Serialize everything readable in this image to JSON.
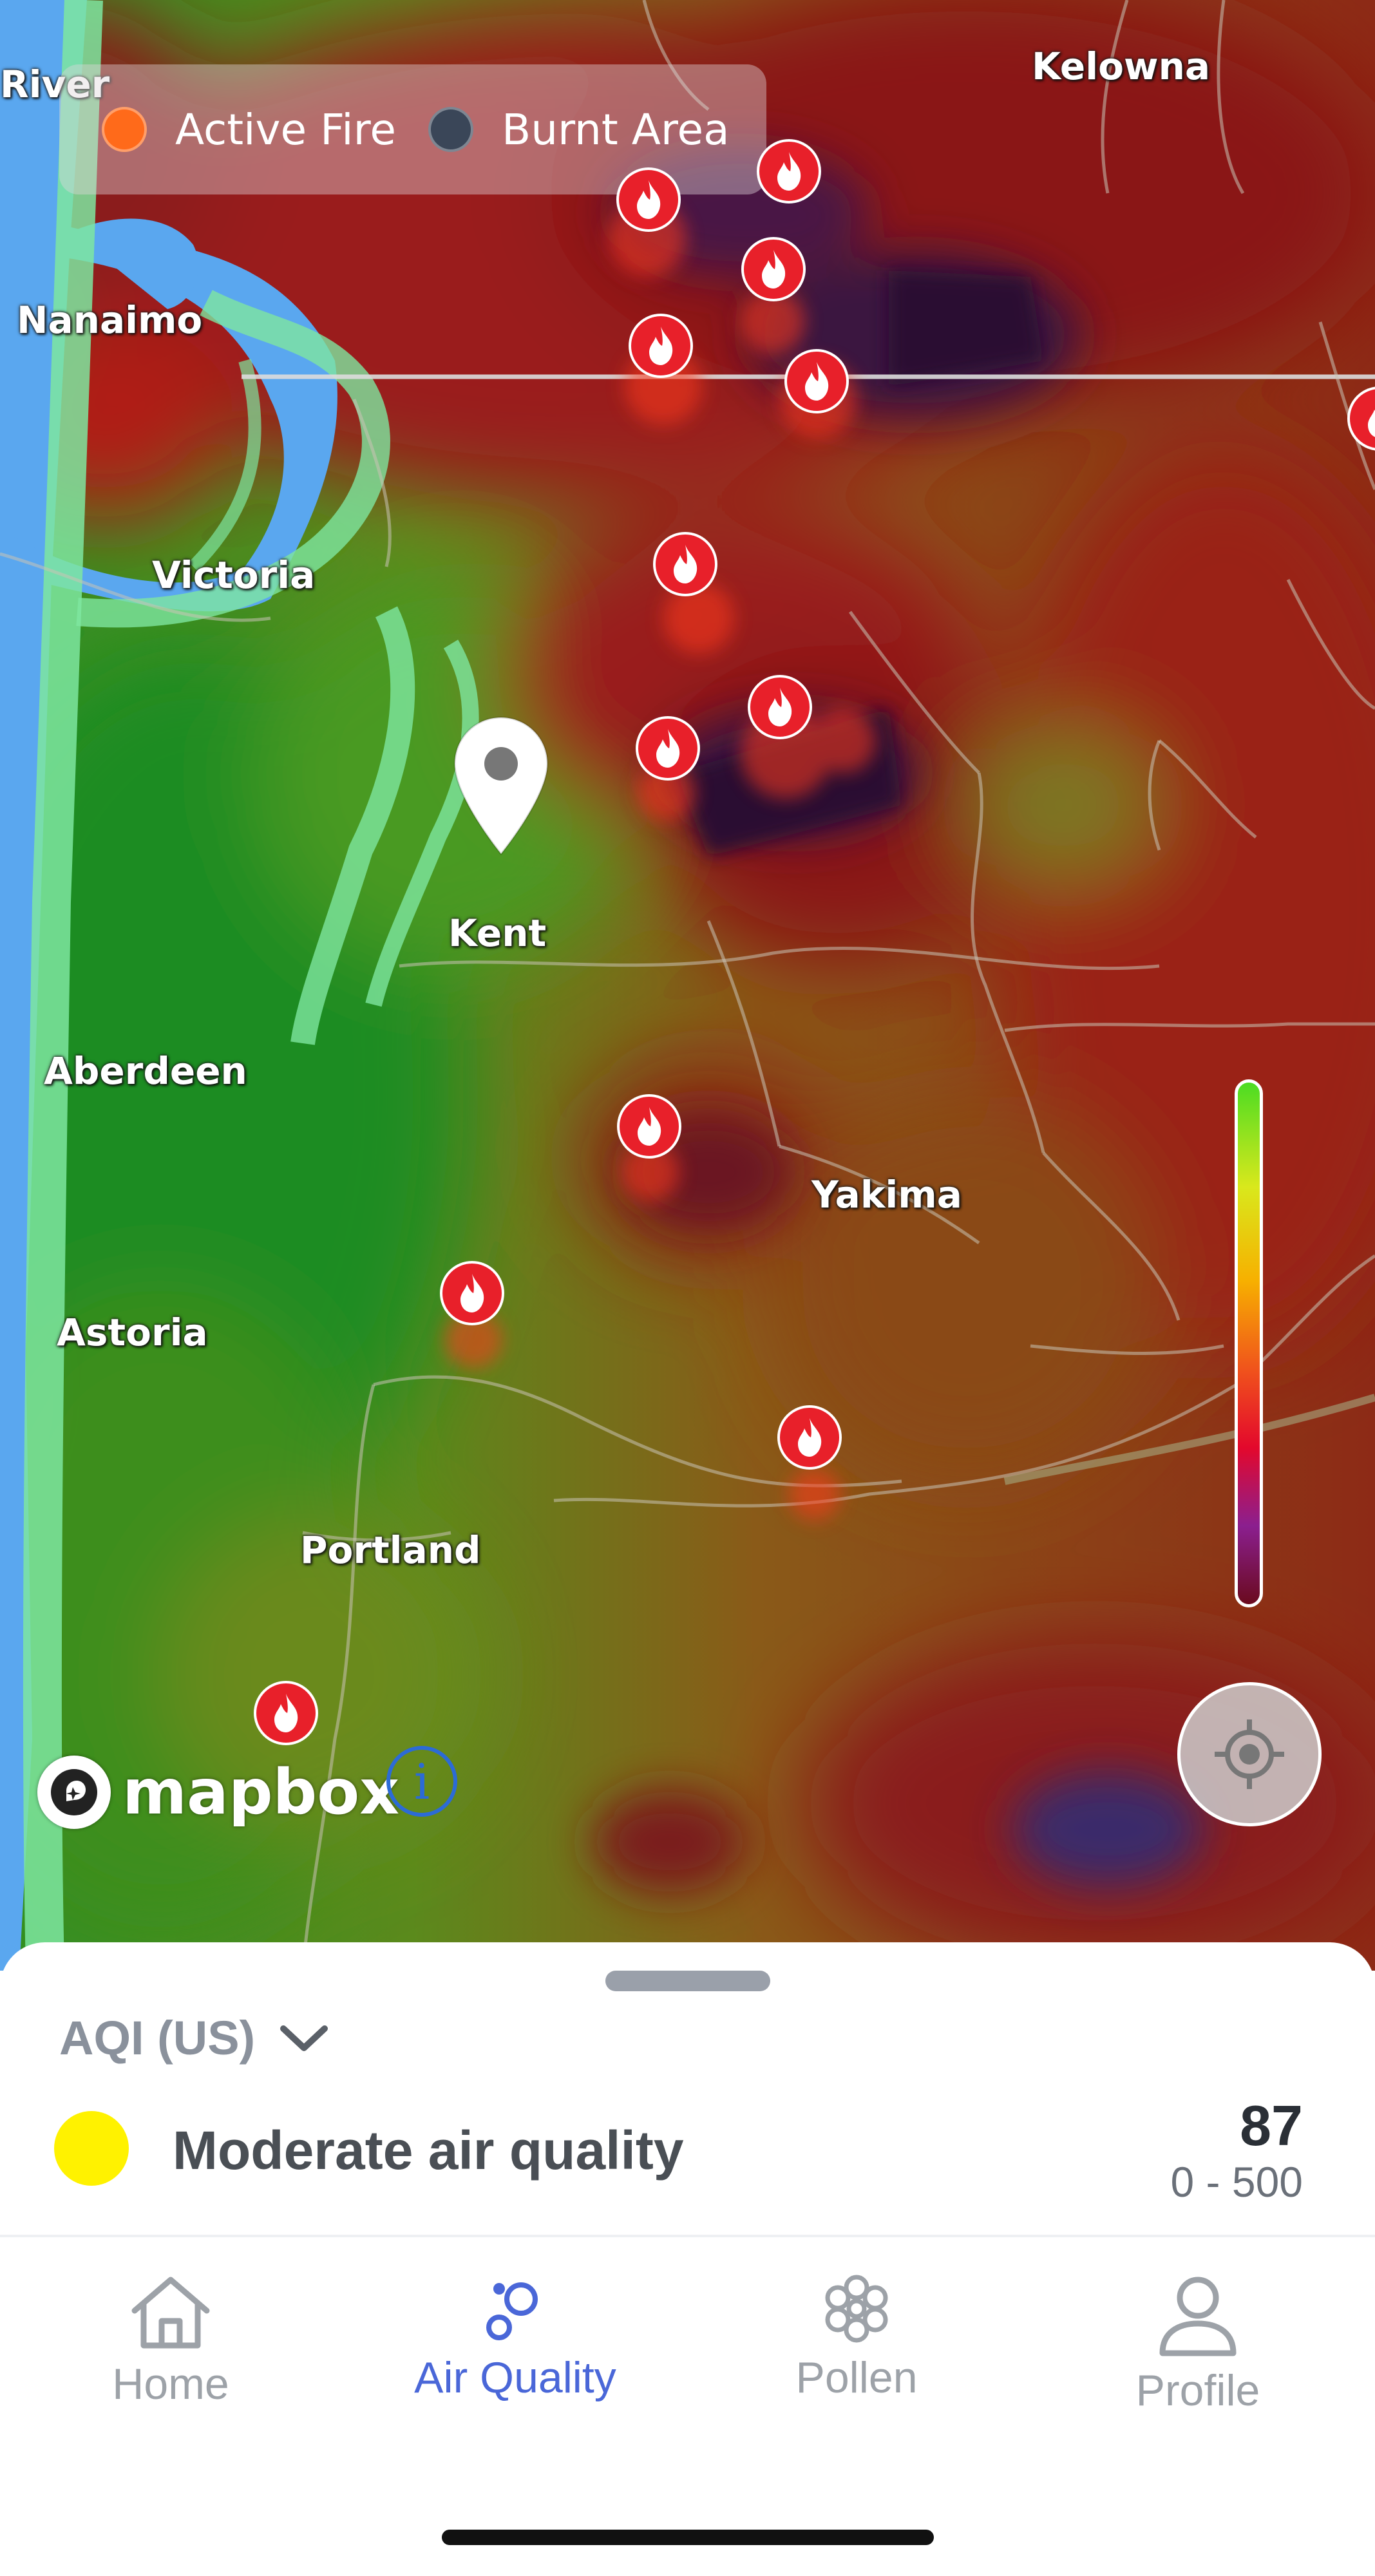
{
  "map": {
    "legend": {
      "items": [
        {
          "label": "Active Fire",
          "color": "#ff6a1a"
        },
        {
          "label": "Burnt Area",
          "color": "#3a4658"
        }
      ]
    },
    "cities": [
      {
        "key": "river",
        "name": "River"
      },
      {
        "key": "kelowna",
        "name": "Kelowna"
      },
      {
        "key": "nanaimo",
        "name": "Nanaimo"
      },
      {
        "key": "victoria",
        "name": "Victoria"
      },
      {
        "key": "kent",
        "name": "Kent"
      },
      {
        "key": "aberdeen",
        "name": "Aberdeen"
      },
      {
        "key": "yakima",
        "name": "Yakima"
      },
      {
        "key": "astoria",
        "name": "Astoria"
      },
      {
        "key": "portland",
        "name": "Portland"
      }
    ],
    "attribution": "mapbox",
    "info_icon": "i",
    "fire_icon": "flame-icon",
    "colors": {
      "fire_marker": "#e8202a",
      "selected_pin": "#ffffff"
    }
  },
  "sheet": {
    "metric_selector": "AQI (US)",
    "status": "Moderate air quality",
    "status_color": "#fff200",
    "aqi_value": "87",
    "aqi_range": "0 - 500"
  },
  "nav": {
    "tabs": [
      {
        "label": "Home",
        "icon": "home-icon",
        "active": false
      },
      {
        "label": "Air Quality",
        "icon": "air-quality-icon",
        "active": true
      },
      {
        "label": "Pollen",
        "icon": "pollen-icon",
        "active": false
      },
      {
        "label": "Profile",
        "icon": "profile-icon",
        "active": false
      }
    ],
    "active_color": "#4a67d8",
    "inactive_color": "#9da2a8"
  }
}
